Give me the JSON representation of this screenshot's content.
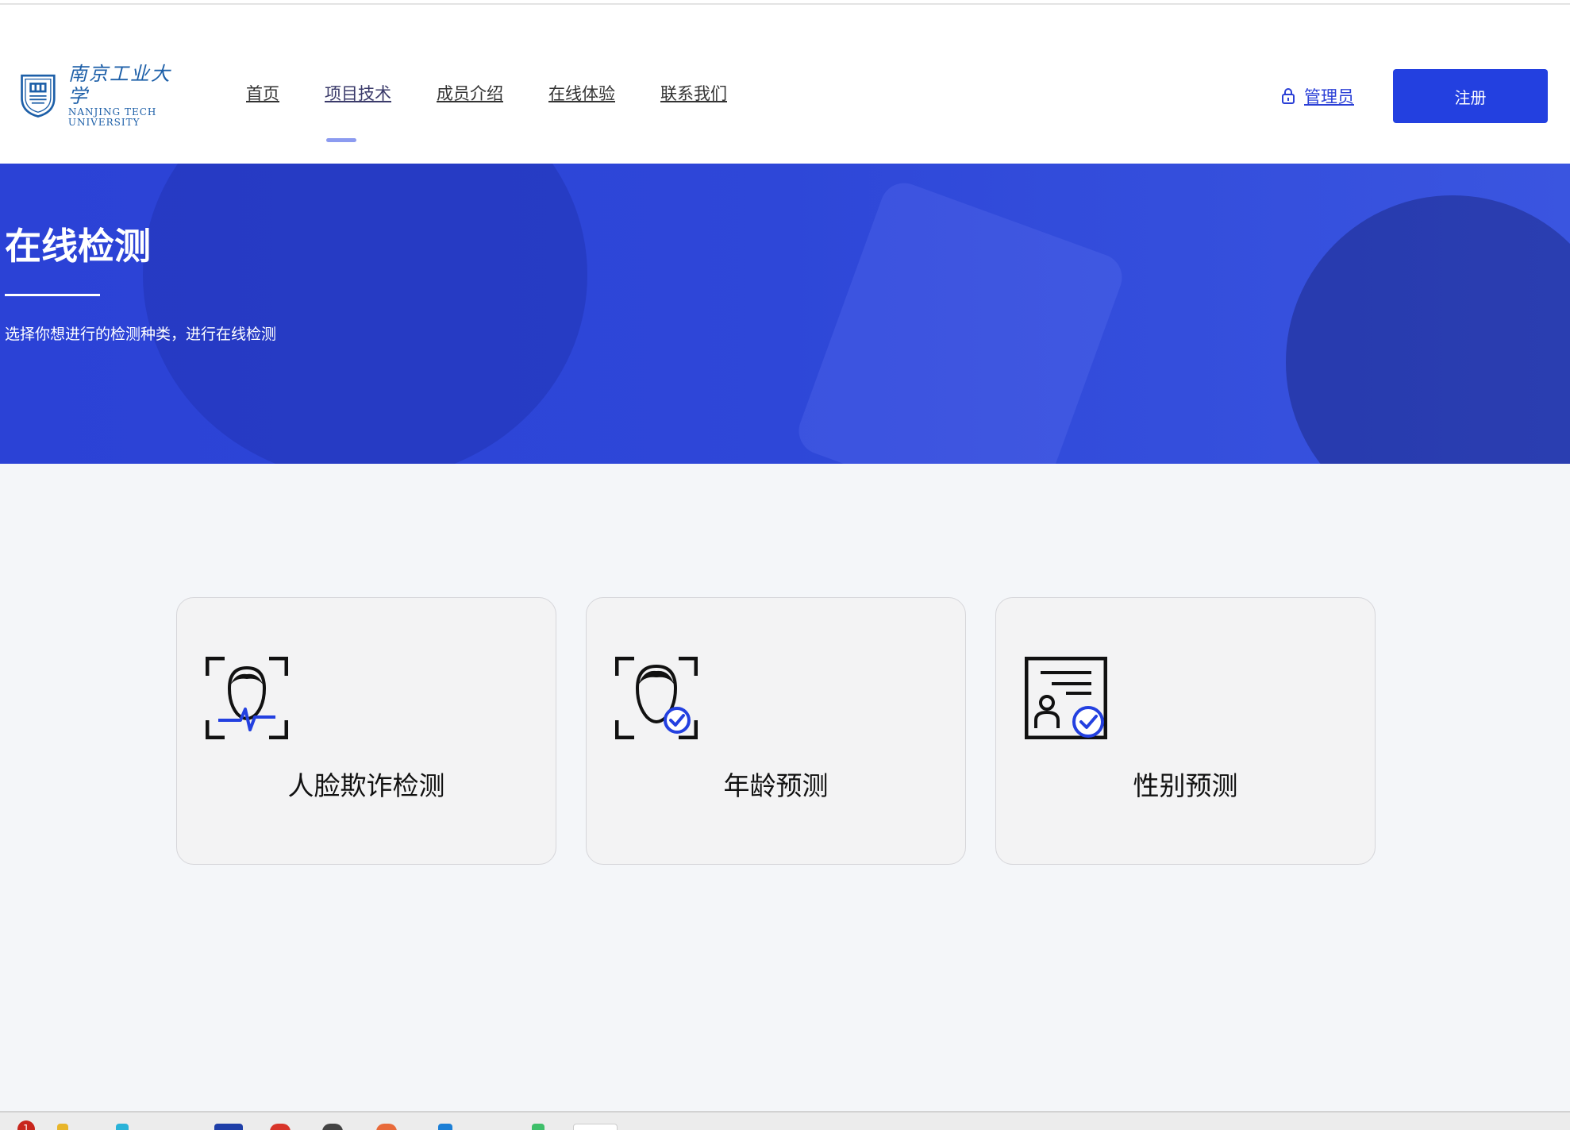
{
  "logo": {
    "cn": "南京工业大学",
    "en_line1": "NANJING TECH",
    "en_line2": "UNIVERSITY"
  },
  "nav": {
    "items": [
      {
        "label": "首页"
      },
      {
        "label": "项目技术"
      },
      {
        "label": "成员介绍"
      },
      {
        "label": "在线体验"
      },
      {
        "label": "联系我们"
      }
    ],
    "active_index": 1
  },
  "header": {
    "admin_label": "管理员",
    "register_label": "注册"
  },
  "hero": {
    "title": "在线检测",
    "subtitle": "选择你想进行的检测种类，进行在线检测"
  },
  "cards": [
    {
      "label": "人脸欺诈检测",
      "icon": "face-scan-pulse-icon"
    },
    {
      "label": "年龄预测",
      "icon": "face-check-icon"
    },
    {
      "label": "性别预测",
      "icon": "id-card-check-icon"
    }
  ],
  "taskbar": {
    "badge": "1"
  },
  "colors": {
    "accent": "#2340e0",
    "hero_bg": "#2e47d8",
    "page_bg": "#f4f6f9",
    "card_bg": "#f3f3f4",
    "logo_blue": "#1d5fa8"
  }
}
